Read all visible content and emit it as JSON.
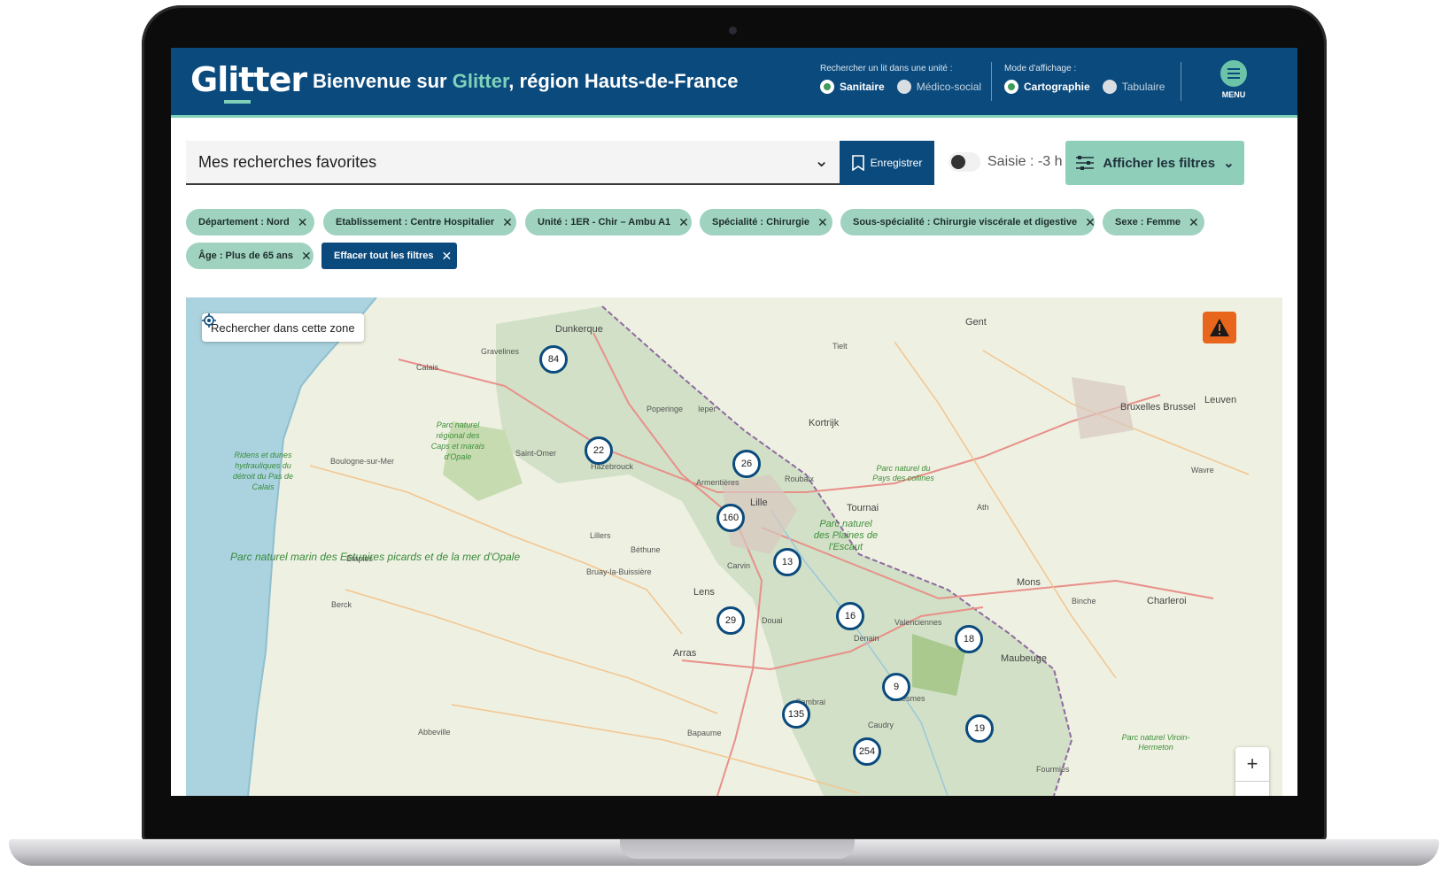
{
  "app": {
    "logo": "Glitter",
    "welcome_prefix": "Bienvenue sur ",
    "welcome_brand": "Glitter",
    "welcome_suffix": ", région Hauts-de-France"
  },
  "bed_search": {
    "label": "Rechercher un lit dans une unité :",
    "options": [
      {
        "label": "Sanitaire",
        "selected": true
      },
      {
        "label": "Médico-social",
        "selected": false
      }
    ]
  },
  "display_mode": {
    "label": "Mode d'affichage :",
    "options": [
      {
        "label": "Cartographie",
        "selected": true
      },
      {
        "label": "Tabulaire",
        "selected": false
      }
    ]
  },
  "menu": {
    "label": "MENU",
    "icon": "hamburger-icon"
  },
  "favorites": {
    "label": "Mes recherches favorites",
    "icon": "chevron-down-icon"
  },
  "save_button": {
    "label": "Enregistrer",
    "icon": "bookmark-icon"
  },
  "saisie": {
    "label": "Saisie : -3 h",
    "enabled": false
  },
  "filters_button": {
    "label": "Afficher les filtres",
    "icon": "sliders-icon"
  },
  "chips": [
    "Département : Nord",
    "Etablissement : Centre Hospitalier",
    "Unité :  1ER - Chir – Ambu A1",
    "Spécialité : Chirurgie",
    "Sous-spécialité : Chirurgie viscérale et digestive",
    "Sexe : Femme",
    "Âge : Plus de 65 ans"
  ],
  "clear_all": "Effacer tout les filtres",
  "map": {
    "search_zone": "Rechercher dans cette zone",
    "zoom_in": "+",
    "clusters": [
      "84",
      "22",
      "26",
      "160",
      "13",
      "29",
      "16",
      "18",
      "9",
      "135",
      "19",
      "254"
    ],
    "places": [
      "Dunkerque",
      "Gravelines",
      "Calais",
      "Saint-Omer",
      "Hazebrouck",
      "Boulogne-sur-Mer",
      "Etaples",
      "Berck",
      "Lillers",
      "Béthune",
      "Bruay-la-Buissière",
      "Lens",
      "Arras",
      "Douai",
      "Carvin",
      "Lille",
      "Roubaix",
      "Tournai",
      "Mons",
      "Valenciennes",
      "Denain",
      "Cambrai",
      "Maubeuge",
      "Bapaume",
      "Abbeville",
      "Bruxelles Brussel",
      "Gent",
      "Kortrijk",
      "Leuven",
      "Wavre",
      "Charleroi",
      "Ieper",
      "Armentières",
      "Ath",
      "Binche",
      "Fourmies",
      "Caudry",
      "Solesmes",
      "Poperinge",
      "Tielt"
    ],
    "parks": [
      "Parc naturel régional des Caps et marais d'Opale",
      "Parc naturel des Plaines de l'Escaut",
      "Parc naturel du Pays des collines",
      "Parc naturel Viroin-Hermeton",
      "Parc naturel marin des Estuaires picards et de la mer d'Opale",
      "Ridens et dunes hydrauliques du détroit du Pas de Calais"
    ]
  }
}
